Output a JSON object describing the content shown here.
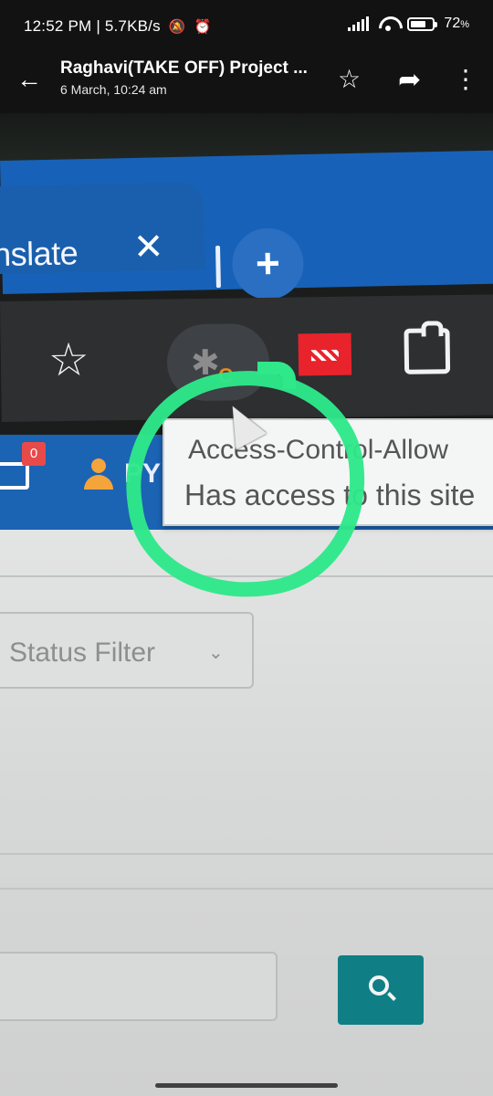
{
  "status_bar": {
    "time": "12:52 PM",
    "network_speed": "| 5.7KB/s",
    "battery": "72",
    "battery_unit": "%",
    "battery_level": 0.72,
    "icons": [
      "mute-icon",
      "alarm-icon",
      "signal-icon",
      "wifi-icon",
      "battery-icon"
    ]
  },
  "app_bar": {
    "title": "Raghavi(TAKE OFF) Project ...",
    "subtitle": "6 March, 10:24 am",
    "back_glyph": "←",
    "star_glyph": "☆",
    "share_glyph": "➦",
    "more_glyph": "⋮"
  },
  "browser": {
    "tab_label": "nslate",
    "tab_close_glyph": "✕",
    "new_tab_glyph": "+",
    "toolbar_star_glyph": "☆",
    "extension_letter": "C",
    "extension_bug_glyph": "✱",
    "tooltip_line1": "Access-Control-Allow",
    "tooltip_line2": "Has access to this site"
  },
  "site": {
    "notification_count": "0",
    "user_name": "PY",
    "status_filter_label": "Status Filter",
    "status_filter_chevron": "⌄"
  },
  "colors": {
    "annotation": "#2ee88a",
    "tab_strip": "#1762b8",
    "search_button": "#0f7f85",
    "extension_badge": "#e98a1c"
  }
}
